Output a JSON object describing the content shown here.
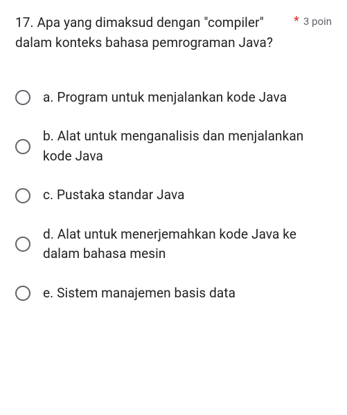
{
  "question": {
    "number_and_text": "17.  Apa yang dimaksud dengan \"compiler\" dalam konteks bahasa pemrograman Java?",
    "required_mark": "*",
    "points": "3 poin"
  },
  "options": [
    {
      "label": "a. Program untuk menjalankan kode Java"
    },
    {
      "label": "b. Alat untuk menganalisis dan menjalankan kode Java"
    },
    {
      "label": "c. Pustaka standar Java"
    },
    {
      "label": "d. Alat untuk menerjemahkan kode Java ke dalam bahasa mesin"
    },
    {
      "label": "e. Sistem manajemen basis data"
    }
  ]
}
